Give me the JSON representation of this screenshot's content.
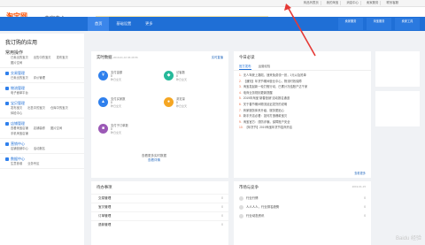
{
  "topbar": {
    "links": [
      "商品列表页",
      "我的淘宝",
      "消息中心",
      "卖家服务",
      "联系客服"
    ]
  },
  "header": {
    "brand": "淘宝网",
    "brand_sub": "Taobao.com",
    "title": "卖家中心",
    "notice_text": "卖家中心的活动有新的升级，卖家可通过下方入口查看，欢迎关注与使用。",
    "notice_link": "查看详情"
  },
  "nav": {
    "tabs": [
      {
        "label": "首页",
        "active": true
      },
      {
        "label": "基础设置",
        "active": false
      },
      {
        "label": "更多",
        "active": false
      }
    ],
    "right": [
      "卖家服务",
      "淘宝服务",
      "卖家工具"
    ]
  },
  "sidebar": {
    "title": "我订购的应用",
    "common": {
      "head": "常用操作",
      "items": [
        "已卖出的宝贝",
        "出售中的宝贝",
        "发布宝贝",
        "图片空间"
      ]
    },
    "groups": [
      {
        "head": "交易管理",
        "items": [
          "已卖出的宝贝",
          "评价管理"
        ]
      },
      {
        "head": "物流管理",
        "items": [
          "电子面单平台"
        ]
      },
      {
        "head": "宝贝管理",
        "items": [
          "发布宝贝",
          "出售中的宝贝",
          "仓库中的宝贝",
          "体检中心"
        ]
      },
      {
        "head": "店铺管理",
        "items": [
          "查看淘宝店铺",
          "店铺装修",
          "图片空间",
          "手机淘宝店铺"
        ]
      },
      {
        "head": "营销中心",
        "items": [
          "店铺营销中心",
          "活动报名"
        ]
      },
      {
        "head": "数据中心",
        "items": [
          "生意参谋",
          "业务专区"
        ]
      }
    ]
  },
  "realtime": {
    "title": "实时数据",
    "meta": "2019-01-16 06:46:56",
    "link": "实时直播",
    "stats": [
      {
        "icon": "¥",
        "label": "支付金额",
        "value": "0",
        "sub": "昨日全天",
        "color": "#2f80ed"
      },
      {
        "icon": "◆",
        "label": "访客数",
        "value": "0",
        "sub": "昨日全天",
        "color": "#26b99a"
      },
      {
        "icon": "▲",
        "label": "支付买家数",
        "value": "0",
        "sub": "昨日全天",
        "color": "#2f80ed"
      },
      {
        "icon": "●",
        "label": "浏览量",
        "value": "0",
        "sub": "昨日全天",
        "color": "#f5a623"
      },
      {
        "icon": "■",
        "label": "支付子订单数",
        "value": "0",
        "sub": "昨日全天",
        "color": "#9b59b6"
      }
    ],
    "zoom_label": "查看更多实时数据",
    "zoom_btn": "查看详情"
  },
  "todo": {
    "title": "待办事项",
    "rows": [
      {
        "label": "交易管理",
        "count": "0"
      },
      {
        "label": "宝贝管理",
        "count": "0"
      },
      {
        "label": "订单管理",
        "count": "0"
      },
      {
        "label": "退款管理",
        "count": "0"
      }
    ]
  },
  "news": {
    "title": "今日必读",
    "tabs": [
      {
        "label": "官方发布",
        "on": true
      },
      {
        "label": "运营经验",
        "on": false
      }
    ],
    "items": [
      "无人驾驶上路啦，速来免费领一张，1元以及抢单",
      "【通知】年货节期间营业中心，物流时效保障",
      "淘宝发起新一轮打假行动，已累计冻结账户达千家",
      "电商业务规则更新提醒",
      "2019年淘宝“新春营销”活动报名通道",
      "关于春节期间物流延迟发货的说明",
      "商家服务体系升级，服务更贴心",
      "新手开店必看：如何打造爆款宝贝",
      "淘宝官方：谨防诈骗，保障账户安全",
      "【年货节】2019淘宝年货节招商开启"
    ],
    "more": "查看更多"
  },
  "market": {
    "title": "市场与竞争",
    "date": "2019-01-15",
    "rows": [
      {
        "label": "行业行情",
        "count": "0"
      },
      {
        "label": "人人人人，行业排名趋势",
        "count": "0"
      },
      {
        "label": "行业动态资讯",
        "count": "0"
      }
    ]
  },
  "watermark": "Baidu 经验",
  "colors": {
    "primary": "#1f6fd6",
    "brand": "#ff5000",
    "annotation": "#e53935"
  }
}
